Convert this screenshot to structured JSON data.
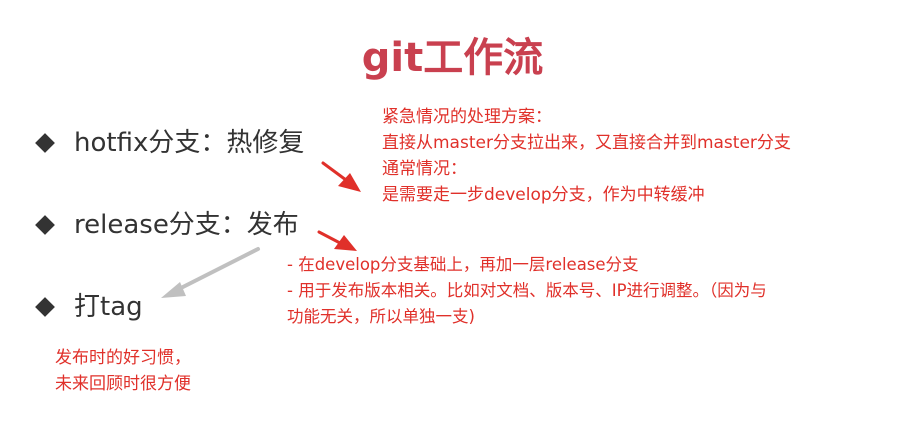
{
  "title": "git工作流",
  "bullets": [
    {
      "label": "hotfix分支：热修复"
    },
    {
      "label": "release分支：发布"
    },
    {
      "label": "打tag"
    }
  ],
  "notes": {
    "hotfix": [
      "紧急情况的处理方案：",
      "直接从master分支拉出来，又直接合并到master分支",
      "通常情况：",
      "是需要走一步develop分支，作为中转缓冲"
    ],
    "release": [
      "- 在develop分支基础上，再加一层release分支",
      "- 用于发布版本相关。比如对文档、版本号、IP进行调整。（因为与",
      "功能无关，所以单独一支)"
    ],
    "tag": [
      "发布时的好习惯，",
      "未来回顾时很方便"
    ]
  },
  "colors": {
    "title": "#c9404f",
    "note_text": "#e0302a",
    "arrow_red": "#e0302a",
    "arrow_gray": "#c0c0c0",
    "body_text": "#333333"
  }
}
